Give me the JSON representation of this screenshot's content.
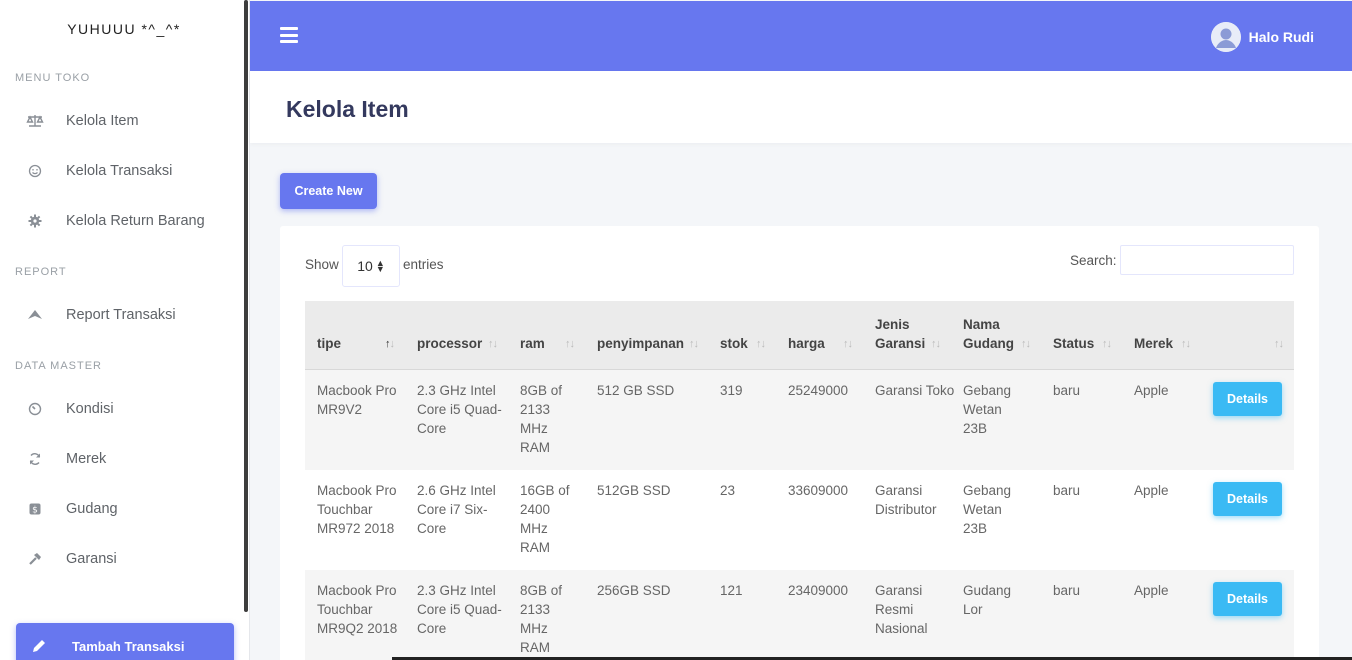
{
  "sidebar": {
    "brand": "YUHUUU *^_^*",
    "sections": [
      {
        "title": "MENU TOKO"
      },
      {
        "title": "REPORT"
      },
      {
        "title": "DATA MASTER"
      }
    ],
    "items": [
      {
        "label": "Kelola Item",
        "icon": "balance-scale-icon"
      },
      {
        "label": "Kelola Transaksi",
        "icon": "smile-icon"
      },
      {
        "label": "Kelola Return Barang",
        "icon": "cog-icon"
      },
      {
        "label": "Report Transaksi",
        "icon": "plane-icon"
      },
      {
        "label": "Kondisi",
        "icon": "gauge-icon"
      },
      {
        "label": "Merek",
        "icon": "sync-icon"
      },
      {
        "label": "Gudang",
        "icon": "dollar-box-icon"
      },
      {
        "label": "Garansi",
        "icon": "hammer-icon"
      }
    ],
    "action": {
      "label": "Tambah Transaksi",
      "icon": "pencil-icon"
    }
  },
  "topbar": {
    "user_name": "Halo Rudi",
    "accent": "#6777ef"
  },
  "page": {
    "title": "Kelola Item",
    "create_label": "Create New"
  },
  "table_controls": {
    "show": "Show",
    "length_value": "10",
    "entries": "entries",
    "search_label": "Search:"
  },
  "table": {
    "headers": {
      "tipe": "tipe",
      "processor": "processor",
      "ram": "ram",
      "penyimpanan": "penyimpanan",
      "stok": "stok",
      "harga": "harga",
      "jenis_garansi": "Jenis Garansi",
      "nama_gudang": "Nama Gudang",
      "status": "Status",
      "merek": "Merek"
    },
    "rows": [
      {
        "tipe": "Macbook Pro MR9V2",
        "processor": "2.3 GHz Intel Core i5 Quad-Core",
        "ram": "8GB of 2133 MHz RAM",
        "penyimpanan": "512 GB SSD",
        "stok": "319",
        "harga": "25249000",
        "garansi": "Garansi Toko",
        "gudang": "Gebang Wetan 23B",
        "status": "baru",
        "merek": "Apple",
        "action": "Details"
      },
      {
        "tipe": "Macbook Pro Touchbar MR972 2018",
        "processor": "2.6 GHz Intel Core i7 Six-Core",
        "ram": "16GB of 2400 MHz RAM",
        "penyimpanan": "512GB SSD",
        "stok": "23",
        "harga": "33609000",
        "garansi": "Garansi Distributor",
        "gudang": "Gebang Wetan 23B",
        "status": "baru",
        "merek": "Apple",
        "action": "Details"
      },
      {
        "tipe": "Macbook Pro Touchbar MR9Q2 2018",
        "processor": "2.3 GHz Intel Core i5 Quad-Core",
        "ram": "8GB of 2133 MHz RAM",
        "penyimpanan": "256GB SSD",
        "stok": "121",
        "harga": "23409000",
        "garansi": "Garansi Resmi Nasional",
        "gudang": "Gudang Lor",
        "status": "baru",
        "merek": "Apple",
        "action": "Details"
      }
    ]
  }
}
